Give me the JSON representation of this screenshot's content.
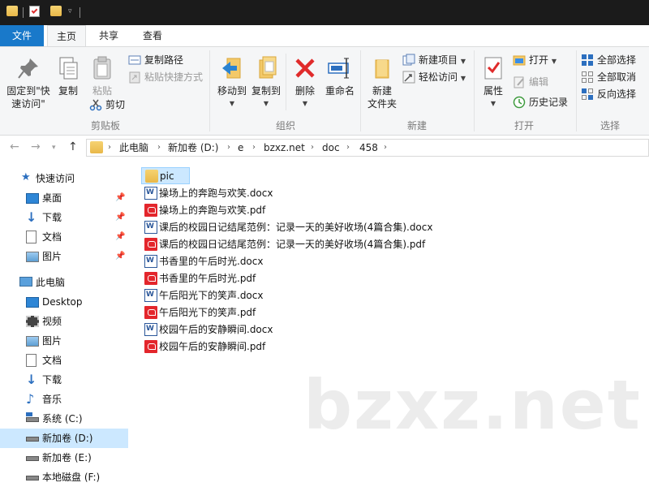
{
  "ribbon_tabs": {
    "file": "文件",
    "home": "主页",
    "share": "共享",
    "view": "查看"
  },
  "clipboard": {
    "pin": "固定到\"快\n速访问\"",
    "pin_line1": "固定到\"快",
    "pin_line2": "速访问\"",
    "copy": "复制",
    "paste": "粘贴",
    "copy_path": "复制路径",
    "paste_shortcut": "粘贴快捷方式",
    "cut": "剪切",
    "group": "剪贴板"
  },
  "organize": {
    "move_to": "移动到",
    "copy_to": "复制到",
    "delete": "删除",
    "rename": "重命名",
    "group": "组织"
  },
  "new": {
    "new_folder_line1": "新建",
    "new_folder_line2": "文件夹",
    "new_item": "新建项目",
    "easy_access": "轻松访问",
    "group": "新建"
  },
  "open": {
    "properties": "属性",
    "open": "打开",
    "edit": "编辑",
    "history": "历史记录",
    "group": "打开"
  },
  "select": {
    "select_all": "全部选择",
    "select_none": "全部取消",
    "invert": "反向选择",
    "group": "选择"
  },
  "breadcrumb": [
    "此电脑",
    "新加卷 (D:)",
    "e",
    "bzxz.net",
    "doc",
    "458"
  ],
  "nav": {
    "quick_access": "快速访问",
    "quick_items": [
      "桌面",
      "下载",
      "文档",
      "图片"
    ],
    "this_pc": "此电脑",
    "pc_items": [
      "Desktop",
      "视频",
      "图片",
      "文档",
      "下载",
      "音乐",
      "系统 (C:)",
      "新加卷 (D:)",
      "新加卷 (E:)",
      "本地磁盘 (F:)"
    ]
  },
  "files": [
    {
      "name": "pic",
      "type": "folder"
    },
    {
      "name": "操场上的奔跑与欢笑.docx",
      "type": "docx"
    },
    {
      "name": "操场上的奔跑与欢笑.pdf",
      "type": "pdf"
    },
    {
      "name": "课后的校园日记结尾范例：记录一天的美好收场(4篇合集).docx",
      "type": "docx"
    },
    {
      "name": "课后的校园日记结尾范例：记录一天的美好收场(4篇合集).pdf",
      "type": "pdf"
    },
    {
      "name": "书香里的午后时光.docx",
      "type": "docx"
    },
    {
      "name": "书香里的午后时光.pdf",
      "type": "pdf"
    },
    {
      "name": "午后阳光下的笑声.docx",
      "type": "docx"
    },
    {
      "name": "午后阳光下的笑声.pdf",
      "type": "pdf"
    },
    {
      "name": "校园午后的安静瞬间.docx",
      "type": "docx"
    },
    {
      "name": "校园午后的安静瞬间.pdf",
      "type": "pdf"
    }
  ],
  "watermark": "bzxz.net",
  "colors": {
    "accent": "#1979ca",
    "selection": "#cce8ff",
    "titlebar": "#1b1b1b",
    "ribbon": "#f5f6f7"
  }
}
